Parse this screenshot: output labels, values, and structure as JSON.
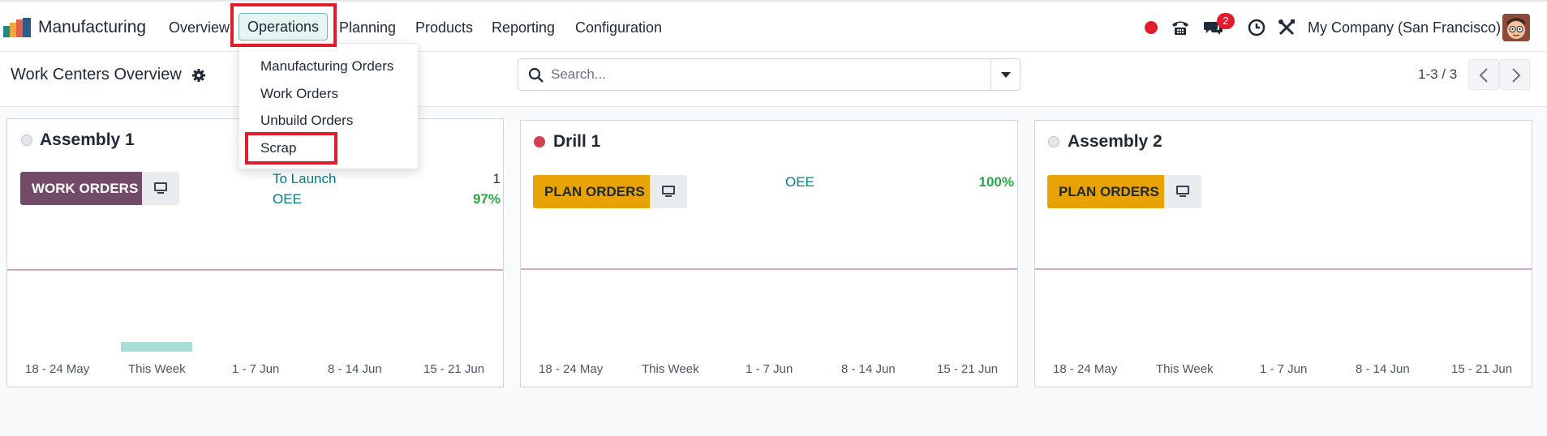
{
  "app": {
    "name": "Manufacturing"
  },
  "nav": {
    "items": [
      "Overview",
      "Operations",
      "Planning",
      "Products",
      "Reporting",
      "Configuration"
    ],
    "active": "Operations"
  },
  "systray": {
    "messages_count": "2",
    "company": "My Company (San Francisco)"
  },
  "operations_menu": {
    "items": [
      "Manufacturing Orders",
      "Work Orders",
      "Unbuild Orders",
      "Scrap"
    ],
    "highlighted": "Scrap"
  },
  "control_panel": {
    "title": "Work Centers Overview",
    "search_placeholder": "Search...",
    "pager": "1-3 / 3"
  },
  "cards": [
    {
      "name": "Assembly 1",
      "status": "grey",
      "button": "WORK ORDERS",
      "stats": [
        {
          "label": "To Launch",
          "value": "1"
        },
        {
          "label": "OEE",
          "value": "97%"
        }
      ],
      "chart_bars": [
        0,
        1,
        0,
        0,
        0
      ]
    },
    {
      "name": "Drill 1",
      "status": "red",
      "button": "PLAN ORDERS",
      "stats": [
        {
          "label": "OEE",
          "value": "100%"
        }
      ],
      "chart_bars": [
        0,
        0,
        0,
        0,
        0
      ]
    },
    {
      "name": "Assembly 2",
      "status": "grey",
      "button": "PLAN ORDERS",
      "stats": [],
      "chart_bars": [
        0,
        0,
        0,
        0,
        0
      ]
    }
  ],
  "week_labels": [
    "18 - 24 May",
    "This Week",
    "1 - 7 Jun",
    "8 - 14 Jun",
    "15 - 21 Jun"
  ],
  "colors": {
    "primary": "#714b67",
    "accent": "#017e84",
    "warning_button": "#e8a202",
    "highlight_box": "#e11d2d",
    "positive": "#28a745"
  }
}
